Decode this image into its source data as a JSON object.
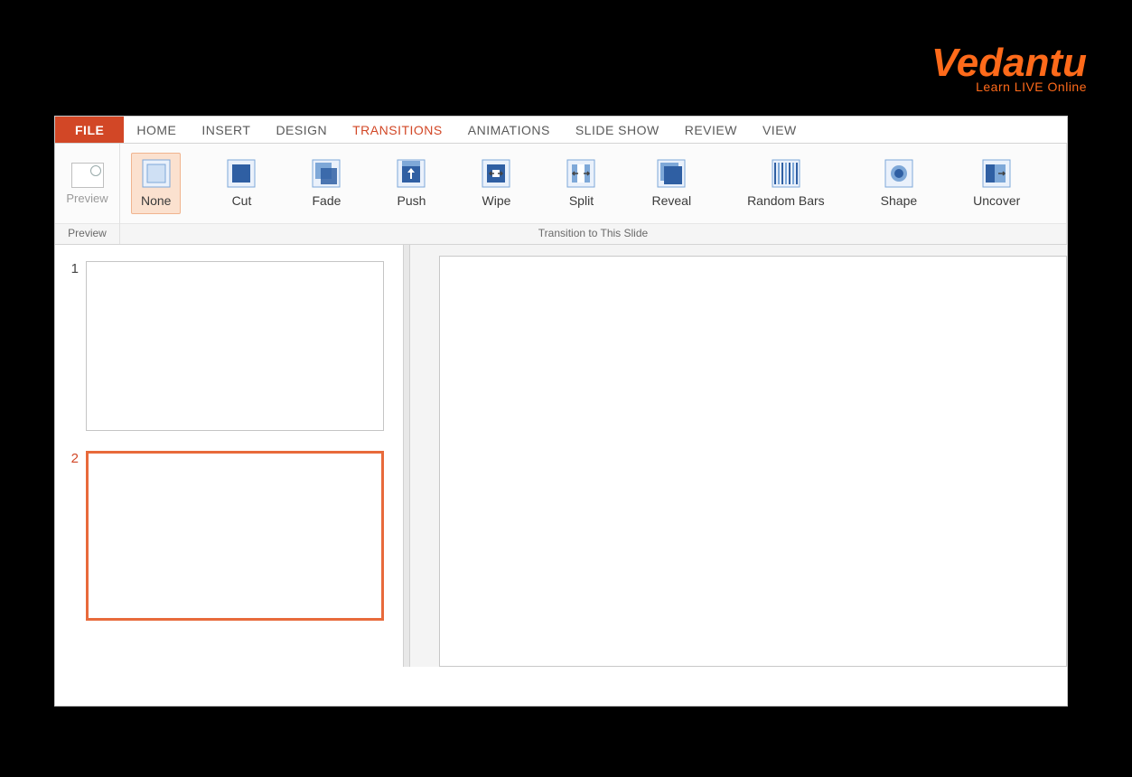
{
  "brand": {
    "wordmark": "Vedantu",
    "tagline": "Learn LIVE Online",
    "color": "#ff6a1a"
  },
  "tabs": {
    "file": {
      "label": "FILE"
    },
    "items": [
      {
        "id": "home",
        "label": "HOME"
      },
      {
        "id": "insert",
        "label": "INSERT"
      },
      {
        "id": "design",
        "label": "DESIGN"
      },
      {
        "id": "transitions",
        "label": "TRANSITIONS",
        "active": true
      },
      {
        "id": "animations",
        "label": "ANIMATIONS"
      },
      {
        "id": "slideshow",
        "label": "SLIDE SHOW"
      },
      {
        "id": "review",
        "label": "REVIEW"
      },
      {
        "id": "view",
        "label": "VIEW"
      }
    ],
    "highlighted_tab": "transitions"
  },
  "ribbon": {
    "preview": {
      "btn_label": "Preview",
      "group_label": "Preview"
    },
    "transitions_group_label": "Transition to This Slide",
    "transitions": [
      {
        "id": "none",
        "label": "None",
        "icon": "none",
        "selected": true
      },
      {
        "id": "cut",
        "label": "Cut",
        "icon": "cut"
      },
      {
        "id": "fade",
        "label": "Fade",
        "icon": "fade"
      },
      {
        "id": "push",
        "label": "Push",
        "icon": "push"
      },
      {
        "id": "wipe",
        "label": "Wipe",
        "icon": "wipe"
      },
      {
        "id": "split",
        "label": "Split",
        "icon": "split"
      },
      {
        "id": "reveal",
        "label": "Reveal",
        "icon": "reveal"
      },
      {
        "id": "randombars",
        "label": "Random Bars",
        "icon": "randombars"
      },
      {
        "id": "shape",
        "label": "Shape",
        "icon": "shape"
      },
      {
        "id": "uncover",
        "label": "Uncover",
        "icon": "uncover"
      }
    ]
  },
  "slides": [
    {
      "number": "1",
      "selected": false
    },
    {
      "number": "2",
      "selected": true
    }
  ],
  "colors": {
    "accent": "#d24726",
    "highlight_box": "#b82525",
    "selection_bg": "#fbe1cf",
    "icon_blue_dark": "#2f5fa3",
    "icon_blue_light": "#7ea8d8"
  }
}
